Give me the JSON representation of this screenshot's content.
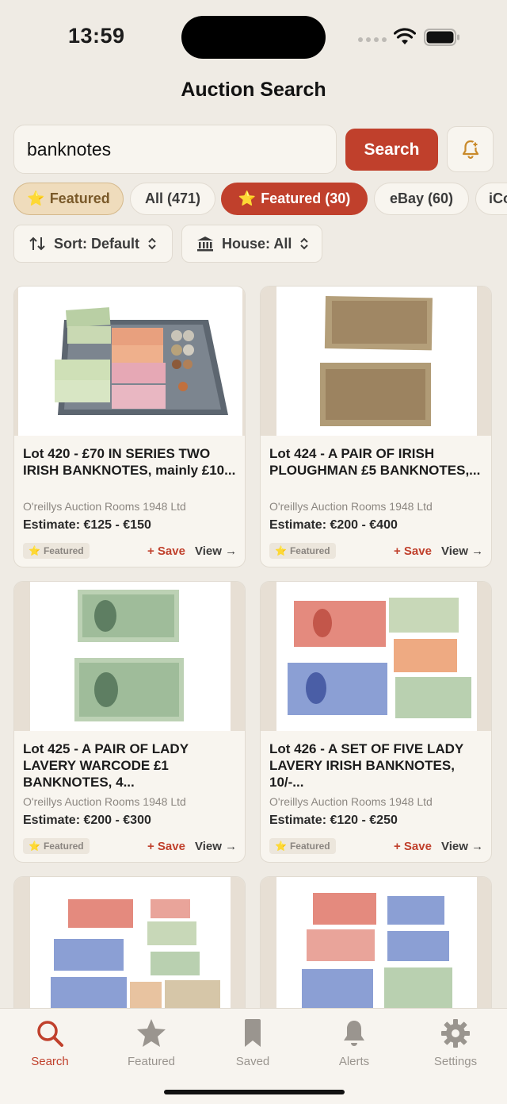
{
  "status_bar": {
    "time": "13:59"
  },
  "nav": {
    "title": "Auction Search"
  },
  "search": {
    "value": "banknotes",
    "button_label": "Search"
  },
  "chips": [
    {
      "label": "Featured",
      "icon": "star-icon",
      "state": "toggle"
    },
    {
      "label": "All (471)",
      "state": "plain"
    },
    {
      "label": "Featured (30)",
      "icon": "star-icon",
      "state": "active"
    },
    {
      "label": "eBay (60)",
      "state": "plain"
    },
    {
      "label": "iCo",
      "state": "plain"
    }
  ],
  "filters": {
    "sort_label": "Sort: Default",
    "house_label": "House: All"
  },
  "cards": [
    {
      "title": "Lot 420 - £70 IN SERIES TWO IRISH BANKNOTES, mainly £10...",
      "house": "O'reillys Auction Rooms 1948 Ltd",
      "estimate": "Estimate: €125 - €150",
      "badge": "Featured",
      "save": "+ Save",
      "view": "View →"
    },
    {
      "title": "Lot 424 - A PAIR OF IRISH PLOUGHMAN £5 BANKNOTES,...",
      "house": "O'reillys Auction Rooms 1948 Ltd",
      "estimate": "Estimate: €200 - €400",
      "badge": "Featured",
      "save": "+ Save",
      "view": "View →"
    },
    {
      "title": "Lot 425 - A PAIR OF LADY LAVERY WARCODE £1 BANKNOTES, 4...",
      "house": "O'reillys Auction Rooms 1948 Ltd",
      "estimate": "Estimate: €200 - €300",
      "badge": "Featured",
      "save": "+ Save",
      "view": "View →"
    },
    {
      "title": "Lot 426 - A SET OF FIVE LADY LAVERY IRISH BANKNOTES, 10/-...",
      "house": "O'reillys Auction Rooms 1948 Ltd",
      "estimate": "Estimate: €120 - €250",
      "badge": "Featured",
      "save": "+ Save",
      "view": "View →"
    }
  ],
  "tabs": [
    {
      "label": "Search",
      "icon": "search-icon",
      "active": true
    },
    {
      "label": "Featured",
      "icon": "star-icon",
      "active": false
    },
    {
      "label": "Saved",
      "icon": "bookmark-icon",
      "active": false
    },
    {
      "label": "Alerts",
      "icon": "bell-icon",
      "active": false
    },
    {
      "label": "Settings",
      "icon": "gear-icon",
      "active": false
    }
  ],
  "colors": {
    "accent": "#c0402c",
    "background": "#efebe4",
    "card": "#f8f5ef"
  }
}
